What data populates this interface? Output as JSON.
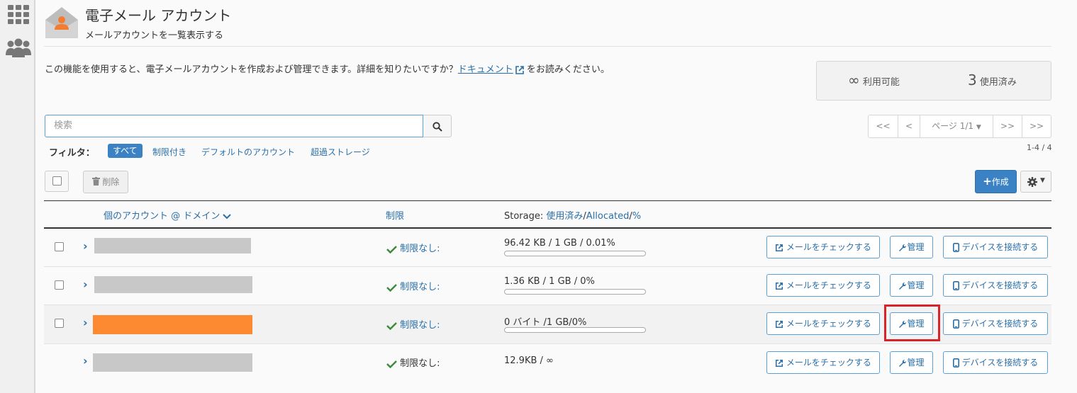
{
  "header": {
    "title": "電子メール アカウント",
    "subtitle": "メールアカウントを一覧表示する"
  },
  "intro": {
    "before": "この機能を使用すると、電子メールアカウントを作成および管理できます。詳細を知りたいですか？",
    "link": "ドキュメント",
    "after": "をお読みください。"
  },
  "stats": {
    "available_value": "∞",
    "available_label": "利用可能",
    "used_value": "3",
    "used_label": "使用済み"
  },
  "search": {
    "placeholder": "検索"
  },
  "filter": {
    "label": "フィルタ：",
    "options": [
      "すべて",
      "制限付き",
      "デフォルトのアカウント",
      "超過ストレージ"
    ]
  },
  "pagination": {
    "first": "<<",
    "prev": "<",
    "page": "ページ 1/1",
    "next": ">>",
    "last": ">>",
    "count": "1-4 / 4"
  },
  "toolbar": {
    "delete": "削除",
    "create": "作成"
  },
  "table": {
    "col_account": "個のアカウント @ ドメイン",
    "col_limit": "制限",
    "col_storage_prefix": "Storage:",
    "col_storage_used": "使用済み",
    "col_storage_allocated": "Allocated",
    "col_storage_pct": "%",
    "rows": [
      {
        "limit": "制限なし:",
        "storage": "96.42 KB / 1 GB / 0.01%",
        "usage": 0.0001
      },
      {
        "limit": "制限なし:",
        "storage": "1.36 KB / 1 GB / 0%",
        "usage": 0
      },
      {
        "limit": "制限なし:",
        "storage": "0 バイト /1 GB/0%",
        "usage": 0
      },
      {
        "limit": "制限なし:",
        "storage": "12.9KB / ∞"
      }
    ],
    "btn_check": "メールをチェックする",
    "btn_manage": "管理",
    "btn_connect": "デバイスを接続する"
  },
  "colors": {
    "accent": "#3b82c4",
    "highlight": "#fd8930",
    "frame": "#d8232a",
    "redacted": "#c8c8c8"
  }
}
